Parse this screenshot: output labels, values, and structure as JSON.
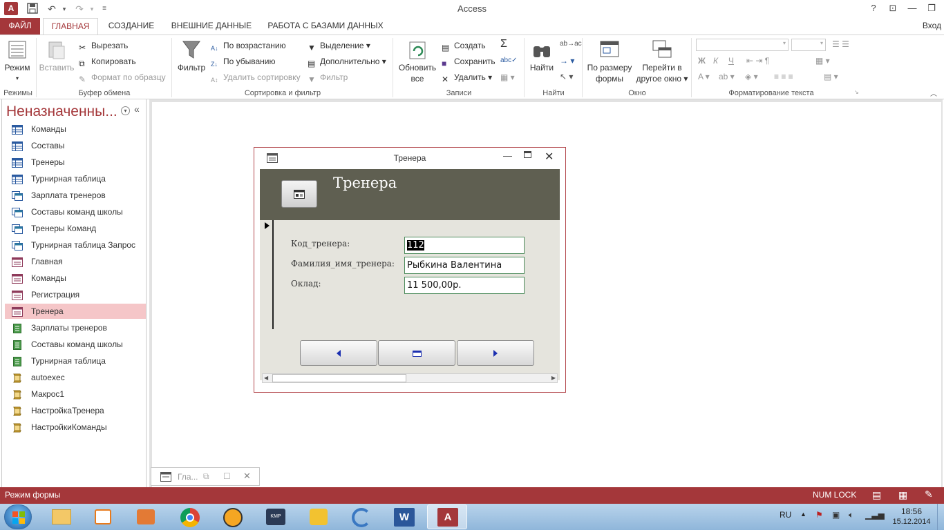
{
  "app": {
    "title": "Access",
    "logo_text": "A",
    "help": "?",
    "signin": "Вход"
  },
  "tabs": {
    "file": "ФАЙЛ",
    "home": "ГЛАВНАЯ",
    "create": "СОЗДАНИЕ",
    "external": "ВНЕШНИЕ ДАННЫЕ",
    "dbtools": "РАБОТА С БАЗАМИ ДАННЫХ"
  },
  "ribbon": {
    "views": {
      "view": "Режим",
      "label": "Режимы"
    },
    "clipboard": {
      "paste": "Вставить",
      "cut": "Вырезать",
      "copy": "Копировать",
      "format_painter": "Формат по образцу",
      "label": "Буфер обмена"
    },
    "sort": {
      "filter": "Фильтр",
      "ascending": "По возрастанию",
      "descending": "По убыванию",
      "remove_sort": "Удалить сортировку",
      "selection": "Выделение",
      "advanced": "Дополнительно",
      "toggle_filter": "Фильтр",
      "label": "Сортировка и фильтр"
    },
    "records": {
      "refresh_line1": "Обновить",
      "refresh_line2": "все",
      "new": "Создать",
      "save": "Сохранить",
      "delete": "Удалить",
      "label": "Записи"
    },
    "find": {
      "find": "Найти",
      "label": "Найти"
    },
    "window": {
      "fit_line1": "По размеру",
      "fit_line2": "формы",
      "switch_line1": "Перейти в",
      "switch_line2": "другое окно",
      "label": "Окно"
    },
    "text": {
      "bold": "Ж",
      "italic": "К",
      "underline": "Ч",
      "label": "Форматирование текста"
    }
  },
  "nav": {
    "title": "Неназначенны...",
    "items": [
      {
        "label": "Команды",
        "type": "table"
      },
      {
        "label": "Составы",
        "type": "table"
      },
      {
        "label": "Тренеры",
        "type": "table"
      },
      {
        "label": "Турнирная таблица",
        "type": "table"
      },
      {
        "label": "Зарплата тренеров",
        "type": "query"
      },
      {
        "label": "Составы команд школы",
        "type": "query"
      },
      {
        "label": "Тренеры Команд",
        "type": "query"
      },
      {
        "label": "Турнирная таблица Запрос",
        "type": "query"
      },
      {
        "label": "Главная",
        "type": "form"
      },
      {
        "label": "Команды",
        "type": "form"
      },
      {
        "label": "Регистрация",
        "type": "form"
      },
      {
        "label": "Тренера",
        "type": "form",
        "selected": true
      },
      {
        "label": "Зарплаты тренеров",
        "type": "report"
      },
      {
        "label": "Составы команд школы",
        "type": "report"
      },
      {
        "label": "Турнирная таблица",
        "type": "report"
      },
      {
        "label": "autoexec",
        "type": "macro"
      },
      {
        "label": "Макрос1",
        "type": "macro"
      },
      {
        "label": "НастройкаТренера",
        "type": "macro"
      },
      {
        "label": "НастройкиКоманды",
        "type": "macro"
      }
    ]
  },
  "form": {
    "window_title": "Тренера",
    "header_title": "Тренера",
    "fields": [
      {
        "label": "Код_тренера:",
        "value": "112"
      },
      {
        "label": "Фамилия_имя_тренера:",
        "value": "Рыбкина Валентина"
      },
      {
        "label": "Оклад:",
        "value": "11 500,00р."
      }
    ]
  },
  "minimized": {
    "label": "Гла..."
  },
  "status": {
    "mode": "Режим формы",
    "numlock": "NUM LOCK"
  },
  "taskbar": {
    "lang": "RU",
    "time": "18:56",
    "date": "15.12.2014"
  },
  "colors": {
    "accent": "#a4373a",
    "form_header": "#5f5f51",
    "form_body": "#e5e4dd",
    "nav_selected": "#f5c6c8"
  }
}
